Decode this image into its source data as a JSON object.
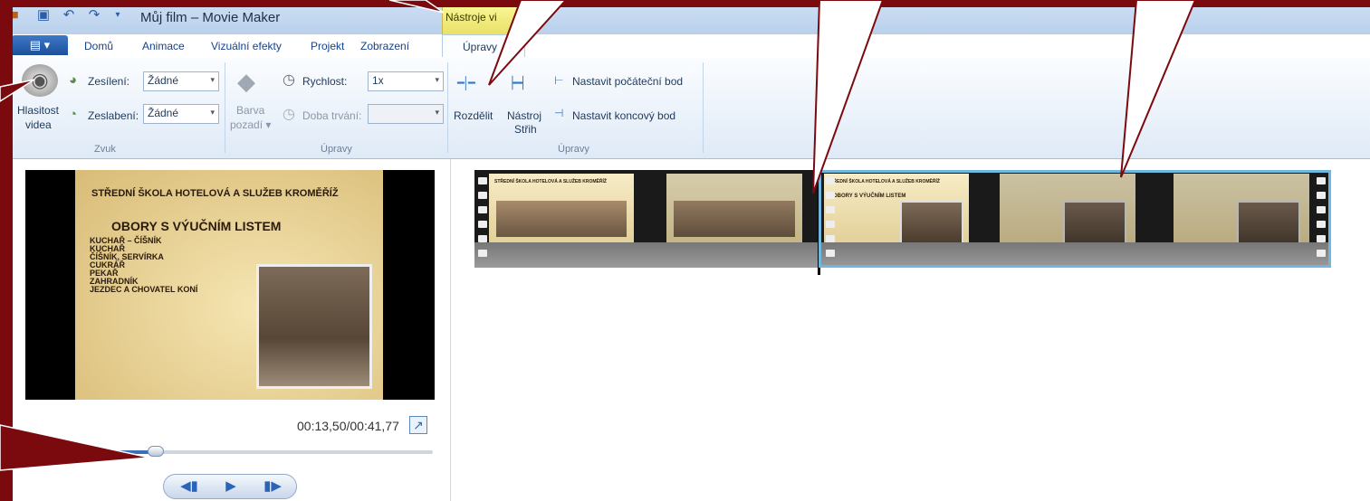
{
  "title_bar": {
    "title": "Můj film – Movie Maker",
    "context_tab": "Nástroje vi"
  },
  "tabs": [
    "Domů",
    "Animace",
    "Vizuální efekty",
    "Projekt",
    "Zobrazení",
    "Úpravy"
  ],
  "ribbon": {
    "audio": {
      "volume_label_line1": "Hlasitost",
      "volume_label_line2": "videa",
      "fade_in_label": "Zesílení:",
      "fade_in_value": "Žádné",
      "fade_out_label": "Zeslabení:",
      "fade_out_value": "Žádné",
      "group_label": "Zvuk"
    },
    "adjust": {
      "background_label_line1": "Barva",
      "background_label_line2": "pozadí ▾",
      "speed_label": "Rychlost:",
      "speed_value": "1x",
      "duration_label": "Doba trvání:",
      "group_label": "Úpravy"
    },
    "editing": {
      "split_label": "Rozdělit",
      "trim_line1": "Nástroj",
      "trim_line2": "Střih",
      "set_start": "Nastavit počáteční bod",
      "set_end": "Nastavit koncový bod",
      "group_label": "Úpravy"
    }
  },
  "preview": {
    "slide_title": "STŘEDNÍ ŠKOLA HOTELOVÁ A SLUŽEB KROMĚŘÍŽ",
    "slide_heading": "OBORY S VÝUČNÍM LISTEM",
    "slide_list": [
      "KUCHAŘ – ČÍŠNÍK",
      "KUCHAŘ",
      "ČÍŠNÍK, SERVÍRKA",
      "CUKRÁŘ",
      "PEKAŘ",
      "ZAHRADNÍK",
      "JEZDEC A CHOVATEL KONÍ"
    ],
    "timecode": "00:13,50/00:41,77",
    "seek_progress": 0.32
  },
  "storyboard": {
    "thumb_caption": "STŘEDNÍ ŠKOLA HOTELOVÁ A SLUŽEB KROMĚŘÍŽ",
    "thumb_heading": "OBORY S VÝUČNÍM LISTEM"
  },
  "icons": {
    "playback": [
      "previous-frame-icon",
      "play-icon",
      "next-frame-icon"
    ]
  },
  "colors": {
    "accent": "#1c4f9a",
    "annotation": "#7a0a0e",
    "selection": "#6fb7df"
  }
}
